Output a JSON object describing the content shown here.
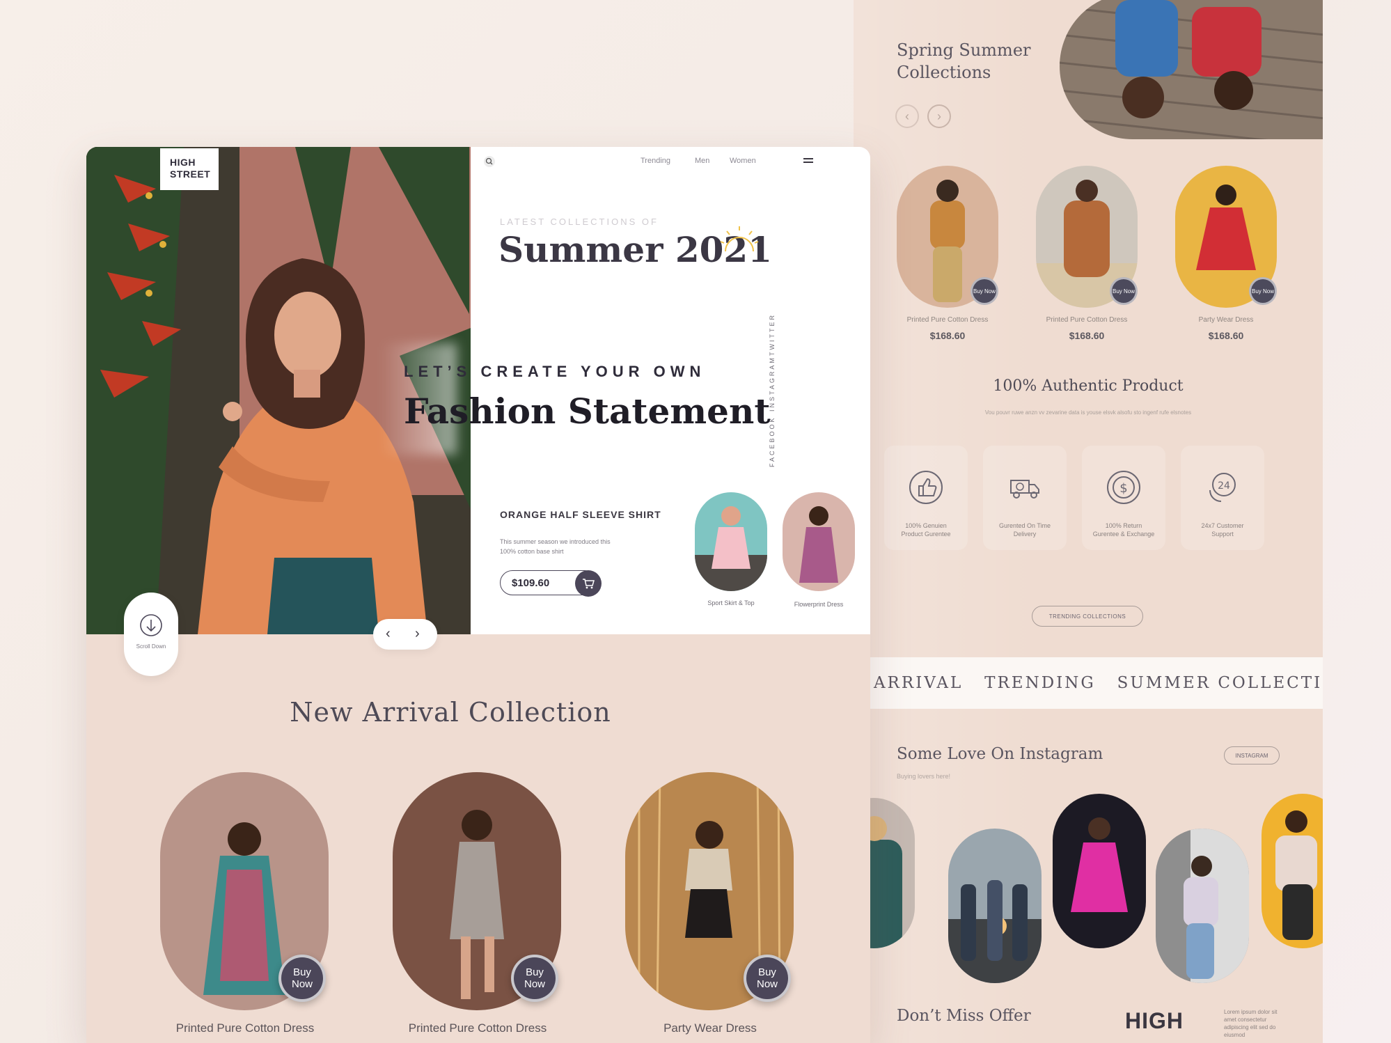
{
  "right": {
    "spring_title_1": "Spring Summer",
    "spring_title_2": "Collections",
    "products": [
      {
        "name": "Printed Pure Cotton Dress",
        "price": "$168.60",
        "buy": "Buy Now"
      },
      {
        "name": "Printed Pure Cotton Dress",
        "price": "$168.60",
        "buy": "Buy Now"
      },
      {
        "name": "Party Wear Dress",
        "price": "$168.60",
        "buy": "Buy Now"
      }
    ],
    "authentic_title": "100% Authentic Product",
    "authentic_sub": "Vou pouvr ruwe anzn vv zevarine data is youse elsvk alsofu sto ingenf rufe elsnotes",
    "features": [
      {
        "icon": "thumbs-up-icon",
        "label1": "100% Genuien",
        "label2": "Product Gurentee"
      },
      {
        "icon": "delivery-truck-icon",
        "label1": "Gurented On Time",
        "label2": "Delivery"
      },
      {
        "icon": "dollar-return-icon",
        "label1": "100% Return",
        "label2": "Gurentee & Exchange"
      },
      {
        "icon": "support-24-icon",
        "label1": "24x7 Customer",
        "label2": "Support"
      }
    ],
    "trending_button": "TRENDING COLLECTIONS",
    "marquee": "W ARRIVAL   TRENDING   SUMMER COLLECTIONS",
    "instagram_title": "Some Love On Instagram",
    "instagram_sub": "Buying lovers here!",
    "instagram_button": "INSTAGRAM",
    "offer_title": "Don’t Miss Offer",
    "offer_brand": "HIGH",
    "offer_text": "Lorem ipsum dolor sit amet consectetur adipiscing elit sed do eiusmod"
  },
  "main": {
    "logo_line1": "HIGH",
    "logo_line2": "STREET",
    "nav": [
      "Trending",
      "Men",
      "Women"
    ],
    "latest_label": "LATEST COLLECTIONS OF",
    "summer_title": "Summer 2021",
    "create_label": "LET’S CREATE YOUR OWN",
    "fashion_title": "Fashion Statement",
    "social": [
      "TWITTER",
      "INSTAGRAM",
      "FACEBOOK"
    ],
    "product_name": "ORANGE HALF SLEEVE SHIRT",
    "product_desc_1": "This summer season we introduced this",
    "product_desc_2": "100% cotton base shirt",
    "product_price": "$109.60",
    "thumbs": [
      "Sport Skirt & Top",
      "Flowerprint Dress"
    ],
    "scroll_down": "Scroll Down",
    "new_arrival_title": "New Arrival Collection",
    "arrivals": [
      {
        "name": "Printed Pure Cotton Dress",
        "buy": "Buy Now"
      },
      {
        "name": "Printed Pure Cotton Dress",
        "buy": "Buy Now"
      },
      {
        "name": "Party Wear Dress",
        "buy": "Buy Now"
      }
    ]
  },
  "colors": {
    "accent_dark": "#4b4659",
    "peach_bg": "#efdcd2",
    "sun_yellow": "#f0c24a"
  }
}
